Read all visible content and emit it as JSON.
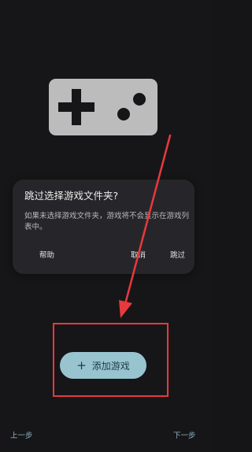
{
  "illustration": {
    "icon": "gamepad-icon",
    "color": "#bcbcbc"
  },
  "dialog": {
    "title": "跳过选择游戏文件夹?",
    "message": "如果未选择游戏文件夹，游戏将不会显示在游戏列表中。",
    "buttons": {
      "help": "帮助",
      "cancel": "取消",
      "skip": "跳过"
    }
  },
  "add_game_button": {
    "icon": "+",
    "label": "添加游戏",
    "color": "#98c4cf"
  },
  "annotation": {
    "color": "#e8393d"
  },
  "nav": {
    "prev": "上一步",
    "next": "下一步"
  }
}
